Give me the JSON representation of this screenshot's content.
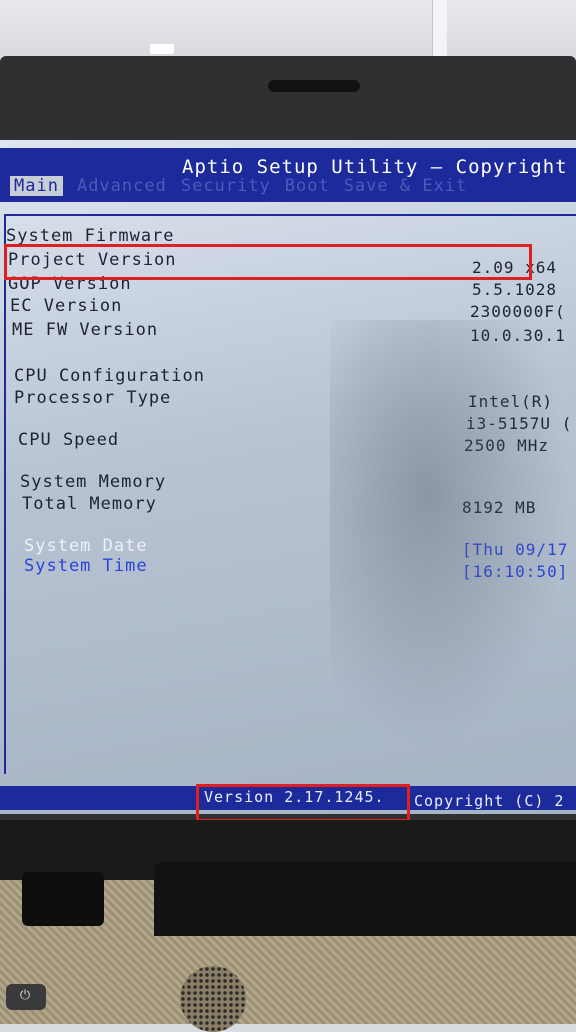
{
  "bios": {
    "title": "Aptio Setup Utility – Copyright",
    "tabs": [
      {
        "label": "Main",
        "active": true
      },
      {
        "label": "Advanced",
        "active": false
      },
      {
        "label": "Security",
        "active": false
      },
      {
        "label": "Boot",
        "active": false
      },
      {
        "label": "Save & Exit",
        "active": false
      }
    ],
    "firmware": {
      "heading": "System Firmware",
      "project_version_label": "Project Version",
      "project_version_value": "2.09 x64",
      "gop_version_label": "GOP Version",
      "gop_version_value": "5.5.1028",
      "ec_version_label": "EC Version",
      "ec_version_value": "2300000F(",
      "me_fw_version_label": "ME FW Version",
      "me_fw_version_value": "10.0.30.1"
    },
    "cpu": {
      "heading": "CPU Configuration",
      "processor_type_label": "Processor Type",
      "processor_type_value_1": "Intel(R)",
      "processor_type_value_2": "i3-5157U (",
      "cpu_speed_label": "CPU Speed",
      "cpu_speed_value": "2500 MHz"
    },
    "memory": {
      "heading": "System Memory",
      "total_memory_label": "Total Memory",
      "total_memory_value": "8192 MB"
    },
    "datetime": {
      "date_label": "System Date",
      "date_value": "[Thu 09/17",
      "time_label": "System Time",
      "time_value": "[16:10:50]"
    },
    "footer": {
      "version": "Version 2.17.1245.",
      "copyright": "Copyright (C) 2"
    }
  },
  "colors": {
    "accent": "#1c2a9c",
    "highlight": "#e0201f",
    "screen": "#b7c3d2"
  },
  "icons": {
    "power": "power-icon"
  }
}
